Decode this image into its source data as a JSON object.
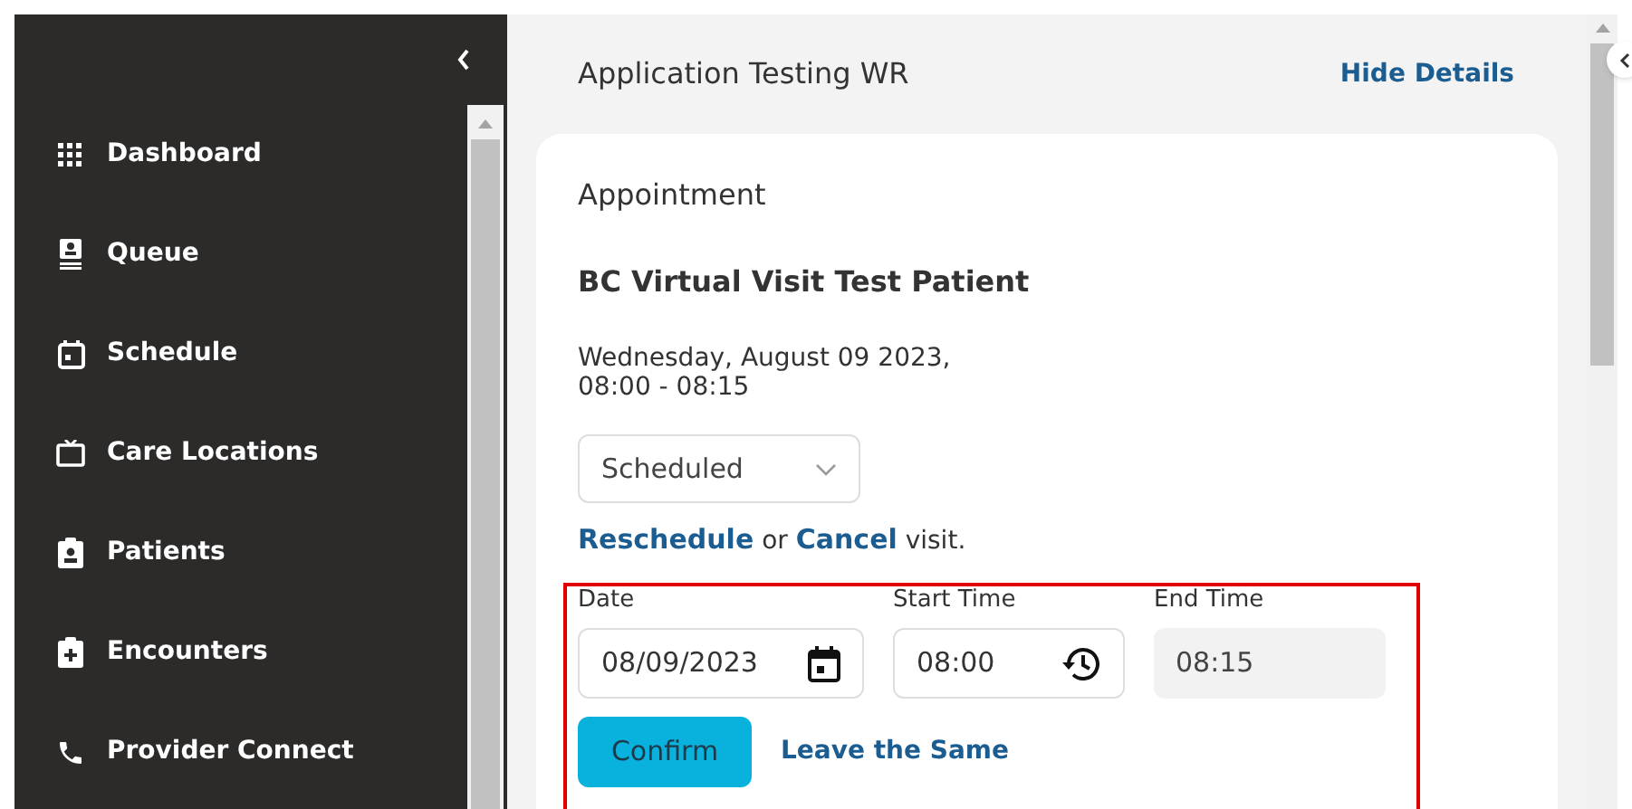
{
  "sidebar": {
    "items": [
      {
        "label": "Dashboard"
      },
      {
        "label": "Queue"
      },
      {
        "label": "Schedule"
      },
      {
        "label": "Care Locations"
      },
      {
        "label": "Patients"
      },
      {
        "label": "Encounters"
      },
      {
        "label": "Provider Connect"
      }
    ]
  },
  "header": {
    "title": "Application Testing WR",
    "action": "Hide Details"
  },
  "card": {
    "heading": "Appointment",
    "patient": "BC Virtual Visit Test Patient",
    "date_line": "Wednesday, August 09 2023,",
    "time_line": "08:00 - 08:15",
    "status_select": {
      "value": "Scheduled"
    },
    "links": {
      "reschedule": "Reschedule",
      "or": "or",
      "cancel": "Cancel",
      "tail": "visit."
    },
    "fields": [
      {
        "label": "Date",
        "value": "08/09/2023",
        "kind": "date",
        "disabled": false
      },
      {
        "label": "Start Time",
        "value": "08:00",
        "kind": "time",
        "disabled": false
      },
      {
        "label": "End Time",
        "value": "08:15",
        "kind": "plain",
        "disabled": true
      }
    ],
    "confirm": "Confirm",
    "leave": "Leave the Same"
  }
}
